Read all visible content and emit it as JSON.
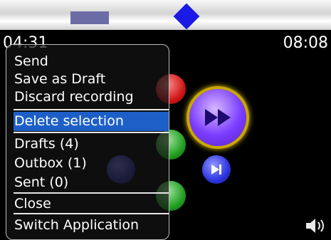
{
  "player": {
    "elapsed": "04:31",
    "total": "08:08"
  },
  "menu": {
    "items": [
      {
        "label": "Send"
      },
      {
        "label": "Save as Draft"
      },
      {
        "label": "Discard recording"
      },
      {
        "label": "Delete selection"
      },
      {
        "label": "Drafts (4)"
      },
      {
        "label": "Outbox (1)"
      },
      {
        "label": "Sent (0)"
      },
      {
        "label": "Close"
      },
      {
        "label": "Switch Application"
      }
    ],
    "selected_index": 3
  },
  "icons": {
    "scrubber": "diamond-scrubber-icon",
    "fast_forward": "fast-forward-icon",
    "next": "next-track-icon",
    "speaker": "speaker-icon"
  },
  "colors": {
    "selection_highlight": "#1d5fc6",
    "scrubber": "#1a19e6",
    "selection_block": "#6b6ca6"
  }
}
